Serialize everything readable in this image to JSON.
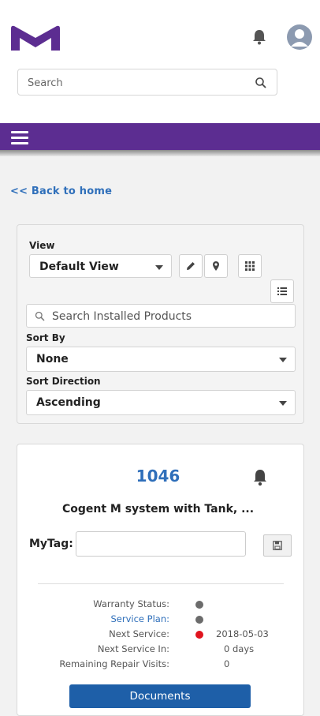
{
  "header": {
    "search_placeholder": "Search"
  },
  "nav": {
    "back_link": "<< Back to home"
  },
  "filters": {
    "view_label": "View",
    "view_value": "Default View",
    "search_placeholder": "Search Installed Products",
    "sort_by_label": "Sort By",
    "sort_by_value": "None",
    "sort_direction_label": "Sort Direction",
    "sort_direction_value": "Ascending"
  },
  "product": {
    "number": "1046",
    "name": "Cogent M system with Tank, ...",
    "mytag_label": "MyTag:",
    "mytag_value": "",
    "details": [
      {
        "label": "Warranty Status:",
        "status_color": "#6b6b6b",
        "value": ""
      },
      {
        "label": "Service Plan:",
        "status_color": "#6b6b6b",
        "value": "",
        "link": true
      },
      {
        "label": "Next Service:",
        "status_color": "#e0141e",
        "value": "2018-05-03"
      },
      {
        "label": "Next Service In:",
        "status_color": "",
        "value": "0 days"
      },
      {
        "label": "Remaining Repair Visits:",
        "status_color": "",
        "value": "0"
      }
    ],
    "documents_button": "Documents"
  },
  "colors": {
    "brand_purple": "#5c2d91",
    "link_blue": "#2f6fba",
    "button_blue": "#1e5fa8"
  },
  "icons": [
    "brand-logo",
    "bell-icon",
    "user-avatar-icon",
    "search-icon",
    "hamburger-menu-icon",
    "pencil-icon",
    "map-pin-icon",
    "grid-view-icon",
    "list-view-icon",
    "save-icon"
  ]
}
